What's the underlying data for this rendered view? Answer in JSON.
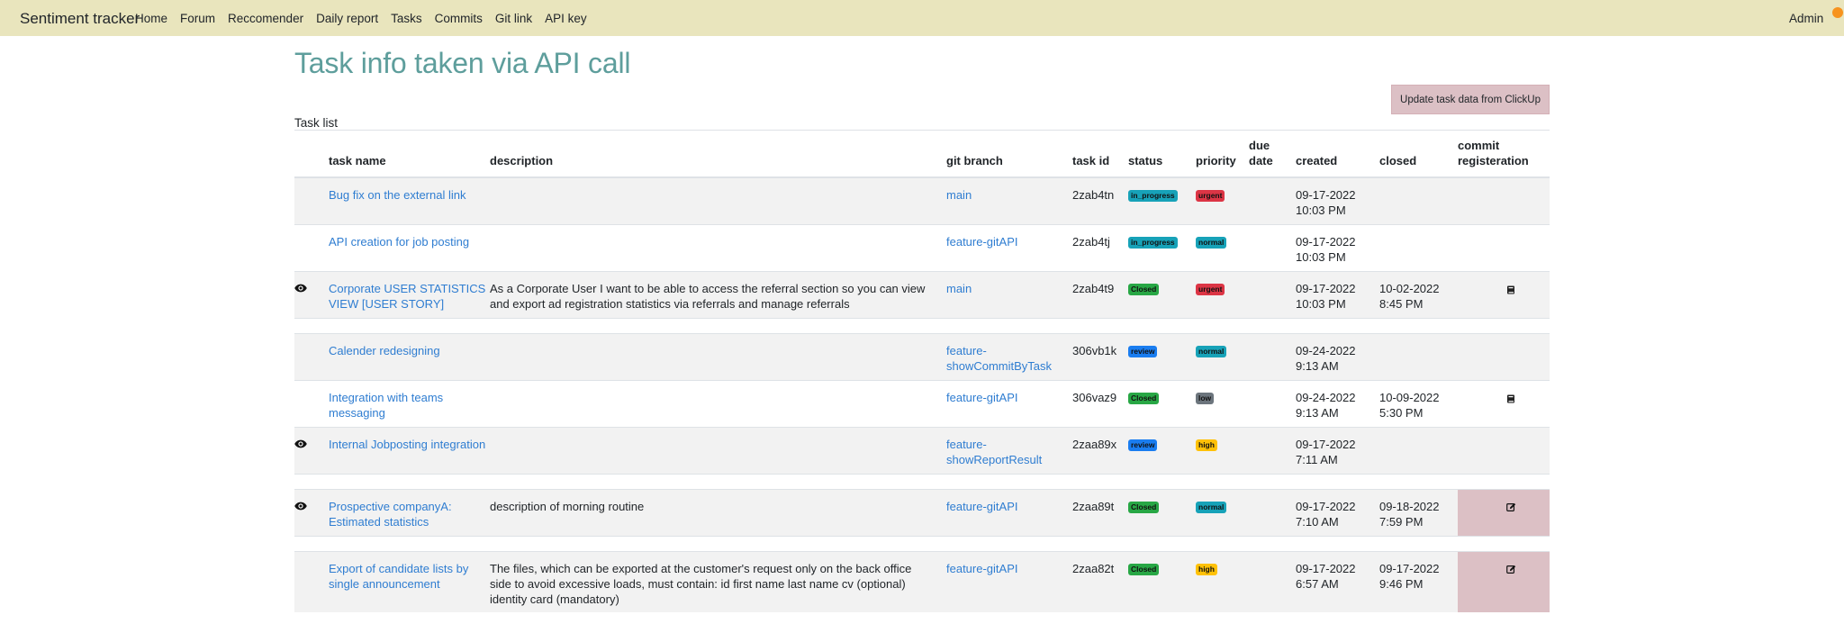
{
  "navbar": {
    "brand": "Sentiment tracker",
    "links": [
      "Home",
      "Forum",
      "Reccomender",
      "Daily report",
      "Tasks",
      "Commits",
      "Git link",
      "API key"
    ],
    "user": "Admin"
  },
  "page": {
    "title": "Task info taken via API call",
    "update_button": "Update task data from ClickUp",
    "caption": "Task list"
  },
  "table": {
    "headers": {
      "name": "task name",
      "description": "description",
      "branch": "git branch",
      "id": "task id",
      "status": "status",
      "priority": "priority",
      "due_l1": "due",
      "due_l2": "date",
      "created": "created",
      "closed": "closed",
      "commit_l1": "commit",
      "commit_l2": "registeration"
    },
    "rows": [
      {
        "eye": false,
        "name": "Bug fix on the external link",
        "description": "",
        "branch": "main",
        "id": "2zab4tn",
        "status": "in_progress",
        "priority": "urgent",
        "due": "",
        "created_date": "09-17-2022",
        "created_time": "10:03 PM",
        "closed_date": "",
        "closed_time": "",
        "commit_icon": ""
      },
      {
        "eye": false,
        "name": "API creation for job posting",
        "description": "",
        "branch": "feature-gitAPI",
        "id": "2zab4tj",
        "status": "in_progress",
        "priority": "normal",
        "due": "",
        "created_date": "09-17-2022",
        "created_time": "10:03 PM",
        "closed_date": "",
        "closed_time": "",
        "commit_icon": ""
      },
      {
        "eye": true,
        "name": "Corporate USER STATISTICS VIEW [USER STORY]",
        "description": "As a Corporate User I want to be able to access the referral section so you can view and export ad registration statistics via referrals and manage referrals",
        "branch": "main",
        "id": "2zab4t9",
        "status": "Closed",
        "priority": "urgent",
        "due": "",
        "created_date": "09-17-2022",
        "created_time": "10:03 PM",
        "closed_date": "10-02-2022",
        "closed_time": "8:45 PM",
        "commit_icon": "book-icon"
      },
      {
        "eye": false,
        "name": "Calender redesigning",
        "description": "",
        "branch": "feature-showCommitByTask",
        "id": "306vb1k",
        "status": "review",
        "priority": "normal",
        "due": "",
        "created_date": "09-24-2022",
        "created_time": "9:13 AM",
        "closed_date": "",
        "closed_time": "",
        "commit_icon": ""
      },
      {
        "eye": false,
        "name": "Integration with teams messaging",
        "description": "",
        "branch": "feature-gitAPI",
        "id": "306vaz9",
        "status": "Closed",
        "priority": "low",
        "due": "",
        "created_date": "09-24-2022",
        "created_time": "9:13 AM",
        "closed_date": "10-09-2022",
        "closed_time": "5:30 PM",
        "commit_icon": "book-icon"
      },
      {
        "eye": true,
        "name": "Internal Jobposting integration",
        "description": "",
        "branch": "feature-showReportResult",
        "id": "2zaa89x",
        "status": "review",
        "priority": "high",
        "due": "",
        "created_date": "09-17-2022",
        "created_time": "7:11 AM",
        "closed_date": "",
        "closed_time": "",
        "commit_icon": ""
      },
      {
        "eye": true,
        "name": "Prospective companyA: Estimated statistics",
        "description": "description of morning routine",
        "branch": "feature-gitAPI",
        "id": "2zaa89t",
        "status": "Closed",
        "priority": "normal",
        "due": "",
        "created_date": "09-17-2022",
        "created_time": "7:10 AM",
        "closed_date": "09-18-2022",
        "closed_time": "7:59 PM",
        "commit_icon": "edit-icon"
      },
      {
        "eye": false,
        "name": "Export of candidate lists by single announcement",
        "description": "The files, which can be exported at the customer's request only on the back office side to avoid excessive loads, must contain: id first name last name cv (optional) identity card (mandatory)",
        "branch": "feature-gitAPI",
        "id": "2zaa82t",
        "status": "Closed",
        "priority": "high",
        "due": "",
        "created_date": "09-17-2022",
        "created_time": "6:57 AM",
        "closed_date": "09-17-2022",
        "closed_time": "9:46 PM",
        "commit_icon": "edit-icon"
      }
    ]
  },
  "colors": {
    "navbar_bg": "#e9e5bd",
    "title": "#5e9e9c",
    "link": "#2f7dd1",
    "accent_pink": "#dcc0c5",
    "notification_dot": "#f7931e"
  }
}
